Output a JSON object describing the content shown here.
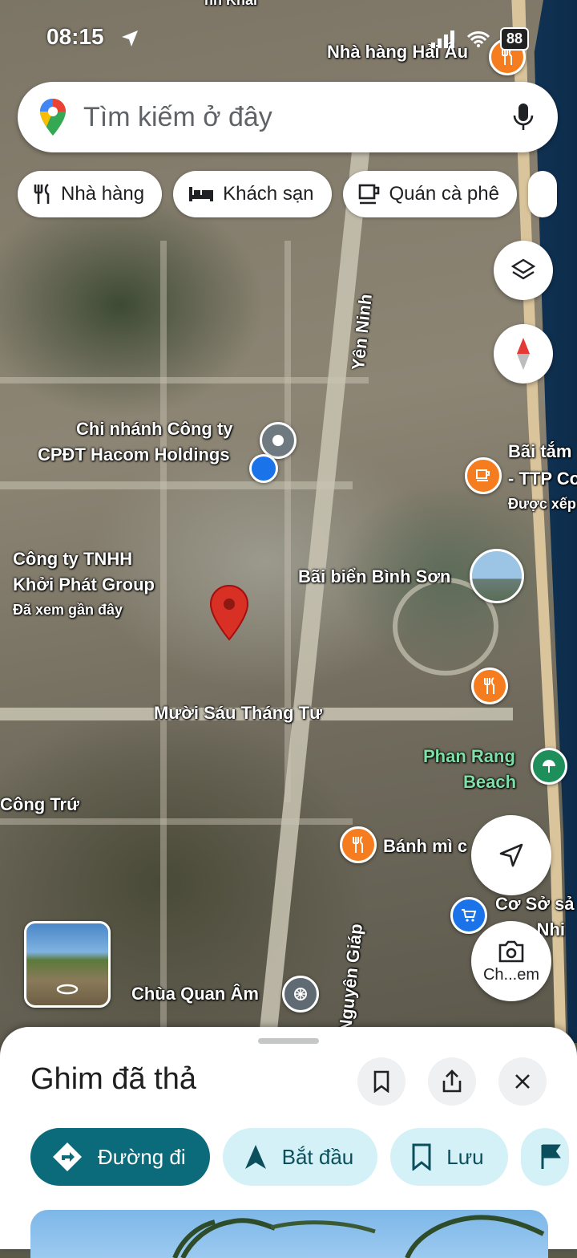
{
  "status_bar": {
    "time": "08:15",
    "battery": "88"
  },
  "search": {
    "placeholder": "Tìm kiếm ở đây"
  },
  "chips": [
    {
      "label": "Nhà hàng",
      "icon": "utensils-icon"
    },
    {
      "label": "Khách sạn",
      "icon": "bed-icon"
    },
    {
      "label": "Quán cà phê",
      "icon": "coffee-icon"
    }
  ],
  "map": {
    "labels": {
      "top_road": "nh Khai",
      "restaurant_hai_au": "Nhà hàng Hải Âu",
      "hacom_line1": "Chi nhánh Công ty",
      "hacom_line2": "CPĐT Hacom Holdings",
      "khoi_phat_line1": "Công ty TNHH",
      "khoi_phat_line2": "Khởi Phát Group",
      "khoi_phat_sub": "Đã xem gần đây",
      "yen_ninh": "Yên Ninh",
      "bai_tam_line1": "Bãi tắm",
      "bai_tam_line2": "- TTP Co",
      "bai_tam_sub": "Được xếp",
      "binh_son": "Bãi biển Bình Sơn",
      "muoi_sau": "Mười Sáu Tháng Tư",
      "phan_rang_line1": "Phan Rang",
      "phan_rang_line2": "Beach",
      "cong_tru": "Công Trứ",
      "banh_mi": "Bánh mì c",
      "co_so_line1": "Cơ Sở sả",
      "co_so_line2": "n Nhi",
      "nguyen_giap": "Nguyên Giáp",
      "chua_quan_am": "Chùa Quan Âm",
      "camera_label": "Ch...em"
    }
  },
  "sheet": {
    "title": "Ghim đã thả",
    "actions": [
      {
        "label": "Đường đi",
        "icon": "directions-icon"
      },
      {
        "label": "Bắt đầu",
        "icon": "navigation-arrow-icon"
      },
      {
        "label": "Lưu",
        "icon": "bookmark-icon"
      }
    ]
  },
  "colors": {
    "accent": "#0b6b7a",
    "pin_red": "#d93025",
    "poi_orange": "#f57c1f"
  }
}
